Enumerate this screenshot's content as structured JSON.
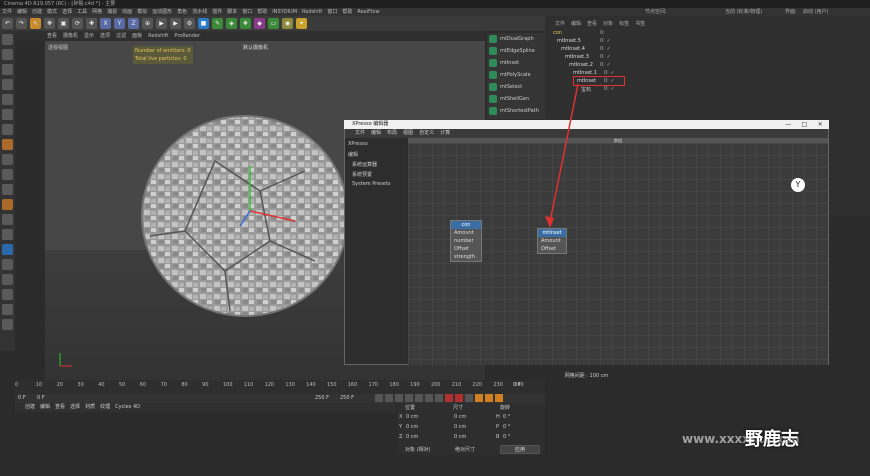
{
  "window": {
    "title": "Cinema 4D R19.057 (RC) - [碎裂.c4d *] - 主要"
  },
  "menubar": [
    "文件",
    "编辑",
    "创建",
    "模式",
    "选择",
    "工具",
    "网格",
    "捕捉",
    "动画",
    "模拟",
    "运动图形",
    "角色",
    "流水线",
    "插件",
    "脚本",
    "窗口",
    "帮助",
    "INSYDIUM",
    "Redshift",
    "窗口",
    "帮助",
    "RealFlow"
  ],
  "rightmenu": {
    "node_space": "节点空间:",
    "node_value": "当前 (标准/物理)",
    "layout": "界面:",
    "layout_value": "启动 (用户)"
  },
  "viewport": {
    "menu": [
      "查看",
      "摄像机",
      "显示",
      "选项",
      "过滤",
      "面板",
      "Redshift",
      "ProRender"
    ],
    "label": "透视视图",
    "camera": "默认摄像机",
    "hud": {
      "emitters": "Number of emitters: 0",
      "particles": "Total live particles: 0"
    }
  },
  "mograph_list": [
    "mtDualGraph",
    "mtEdgeSpline",
    "mtInset",
    "mtPolyScale",
    "mtSelect",
    "mtShellGen",
    "mtShortestPath"
  ],
  "object_manager": {
    "header": [
      "文件",
      "编辑",
      "查看",
      "对象",
      "标签",
      "书签"
    ],
    "items": [
      {
        "name": "con",
        "tag": "0:"
      },
      {
        "name": "mtInset.5",
        "tag": "0: ✓"
      },
      {
        "name": "mtInset.4",
        "tag": "0: ✓"
      },
      {
        "name": "mtInset.3",
        "tag": "0: ✓"
      },
      {
        "name": "mtInset.2",
        "tag": "0: ✓"
      },
      {
        "name": "mtInset.1",
        "tag": "0: ✓"
      },
      {
        "name": "mtInset",
        "tag": "0: ✓"
      },
      {
        "name": "宝石",
        "tag": "0: ✓"
      }
    ]
  },
  "xpresso": {
    "title": "XPresso 编辑器",
    "controls": [
      "—",
      "□",
      "✕"
    ],
    "menu": [
      "文件",
      "编辑",
      "布局",
      "视图",
      "自定义",
      "计算"
    ],
    "left_items": [
      "XPresso",
      "编辑",
      "系统运算器",
      "系统预置",
      "System Presets"
    ],
    "grid_title": "群组",
    "status": "网格间距 : 100 cm",
    "nodes": [
      {
        "title": "con",
        "ports": [
          "Amount",
          "number",
          "Offset",
          "strength"
        ]
      },
      {
        "title": "mtInset",
        "ports": [
          "Amount",
          "Offset"
        ]
      }
    ]
  },
  "timeline": {
    "ticks": [
      "0",
      "10",
      "20",
      "30",
      "40",
      "50",
      "60",
      "70",
      "80",
      "90",
      "100",
      "110",
      "120",
      "130",
      "140",
      "150",
      "160",
      "170",
      "180",
      "190",
      "200",
      "210",
      "220",
      "230",
      "240",
      "25"
    ],
    "current": "0 F",
    "frame_start": "0 F",
    "frame_mid": "0 F",
    "frame_end": "250 F",
    "frame_end2": "250 F"
  },
  "material_bar": [
    "创建",
    "编辑",
    "查看",
    "选择",
    "材质",
    "纹理",
    "Cycles 4D"
  ],
  "coords": {
    "headers": [
      "位置",
      "尺寸",
      "旋转"
    ],
    "rows": [
      {
        "axis": "X",
        "pos": "0 cm",
        "size": "0 cm",
        "rot_axis": "H",
        "rot": "0 °"
      },
      {
        "axis": "Y",
        "pos": "0 cm",
        "size": "0 cm",
        "rot_axis": "P",
        "rot": "0 °"
      },
      {
        "axis": "Z",
        "pos": "0 cm",
        "size": "0 cm",
        "rot_axis": "B",
        "rot": "0 °"
      }
    ],
    "mode1": "对象 (相对)",
    "mode2": "绝对尺寸",
    "apply": "应用"
  },
  "watermark": {
    "text": "野鹿志",
    "url": "www.xxxxnu.com"
  },
  "colors": {
    "highlight": "#e03030",
    "node_header": "#3a6ea5",
    "hud_text": "#e8c15a"
  }
}
